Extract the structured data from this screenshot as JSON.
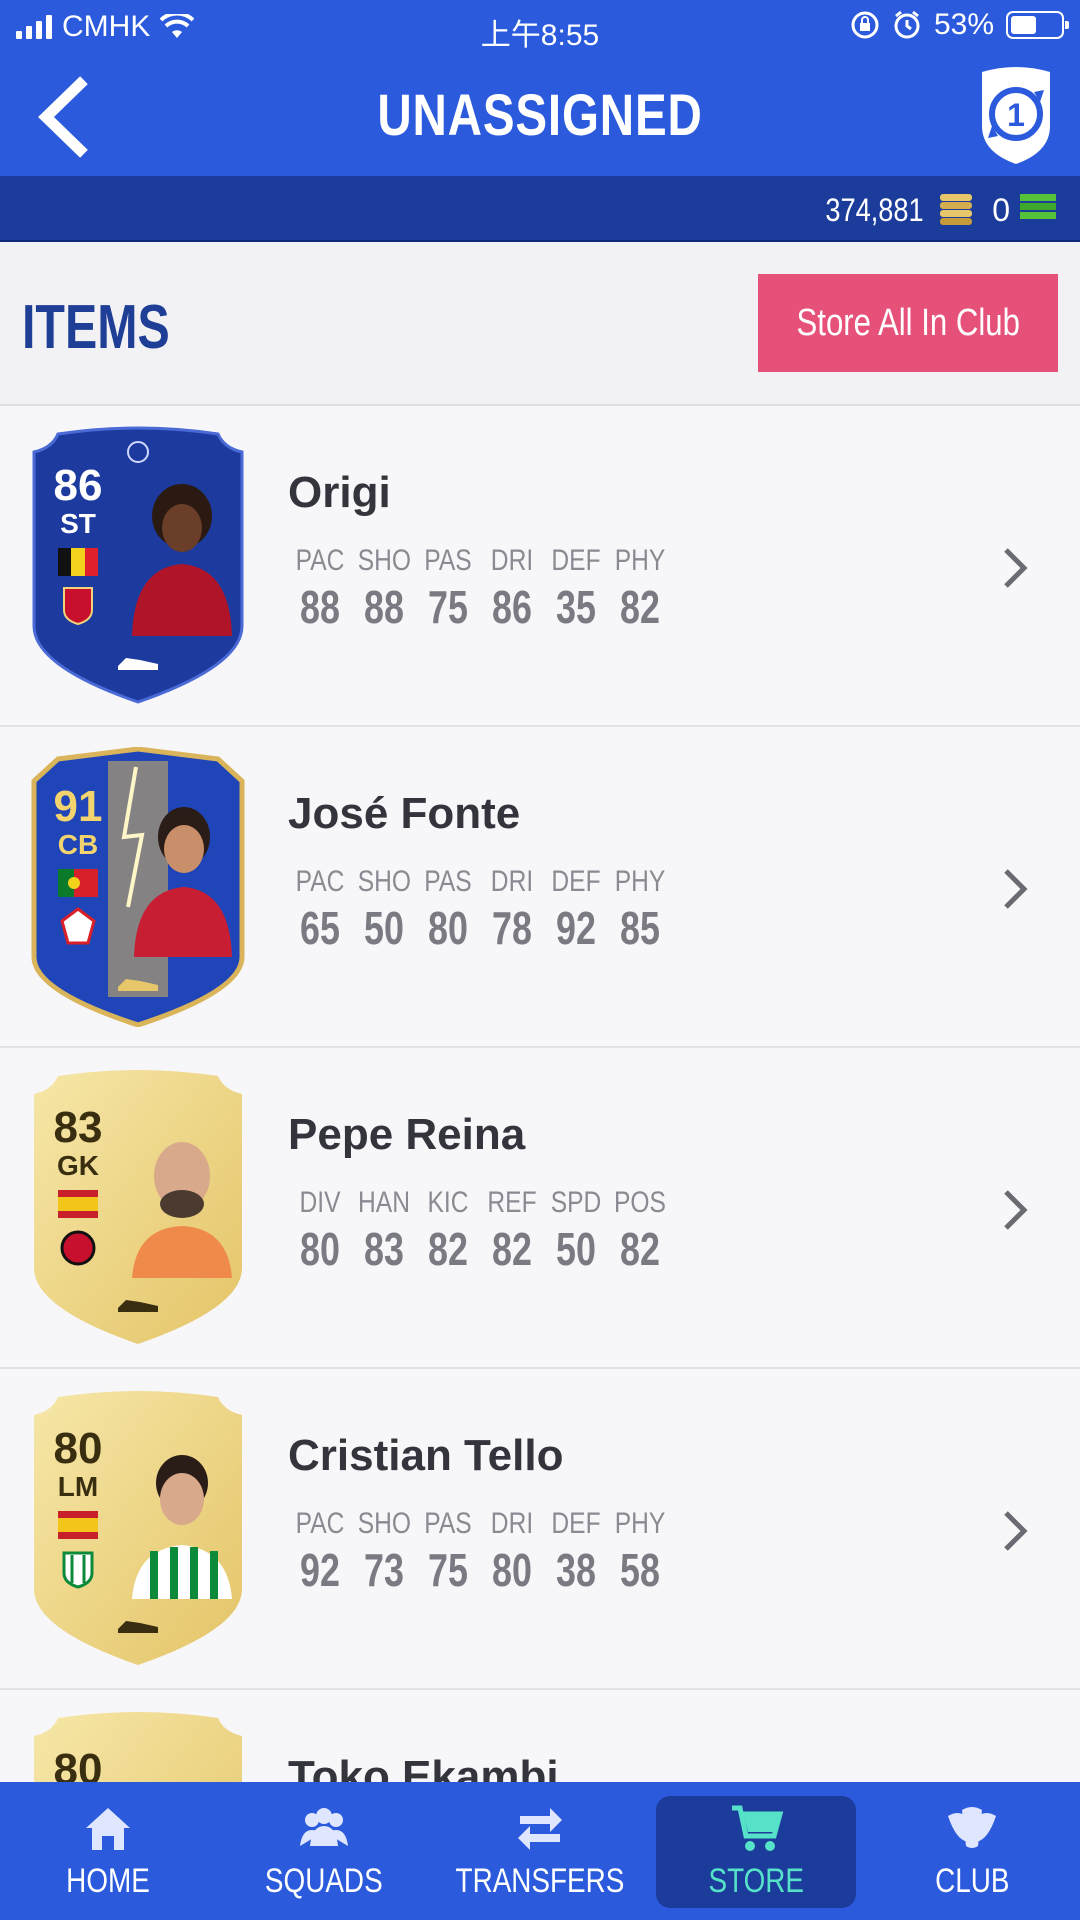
{
  "status_bar": {
    "carrier": "CMHK",
    "time": "上午8:55",
    "battery": "53%"
  },
  "header": {
    "title": "UNASSIGNED",
    "sync_badge": "1"
  },
  "currency": {
    "coins": "374,881",
    "points": "0"
  },
  "items_section": {
    "title": "ITEMS",
    "store_all_label": "Store All In Club"
  },
  "players": [
    {
      "name": "Origi",
      "rating": "86",
      "position": "ST",
      "stat_labels": [
        "PAC",
        "SHO",
        "PAS",
        "DRI",
        "DEF",
        "PHY"
      ],
      "stat_values": [
        "88",
        "88",
        "75",
        "86",
        "35",
        "82"
      ]
    },
    {
      "name": "José Fonte",
      "rating": "91",
      "position": "CB",
      "stat_labels": [
        "PAC",
        "SHO",
        "PAS",
        "DRI",
        "DEF",
        "PHY"
      ],
      "stat_values": [
        "65",
        "50",
        "80",
        "78",
        "92",
        "85"
      ]
    },
    {
      "name": "Pepe Reina",
      "rating": "83",
      "position": "GK",
      "stat_labels": [
        "DIV",
        "HAN",
        "KIC",
        "REF",
        "SPD",
        "POS"
      ],
      "stat_values": [
        "80",
        "83",
        "82",
        "82",
        "50",
        "82"
      ]
    },
    {
      "name": "Cristian Tello",
      "rating": "80",
      "position": "LM",
      "stat_labels": [
        "PAC",
        "SHO",
        "PAS",
        "DRI",
        "DEF",
        "PHY"
      ],
      "stat_values": [
        "92",
        "73",
        "75",
        "80",
        "38",
        "58"
      ]
    },
    {
      "name": "Toko Ekambi",
      "rating": "80"
    }
  ],
  "nav": {
    "items": [
      {
        "label": "HOME"
      },
      {
        "label": "SQUADS"
      },
      {
        "label": "TRANSFERS"
      },
      {
        "label": "STORE"
      },
      {
        "label": "CLUB"
      }
    ],
    "active_color": "#55e2c8"
  },
  "colors": {
    "primary": "#2b5bdc",
    "dark": "#1c3c9c",
    "accent": "#e6517a"
  }
}
